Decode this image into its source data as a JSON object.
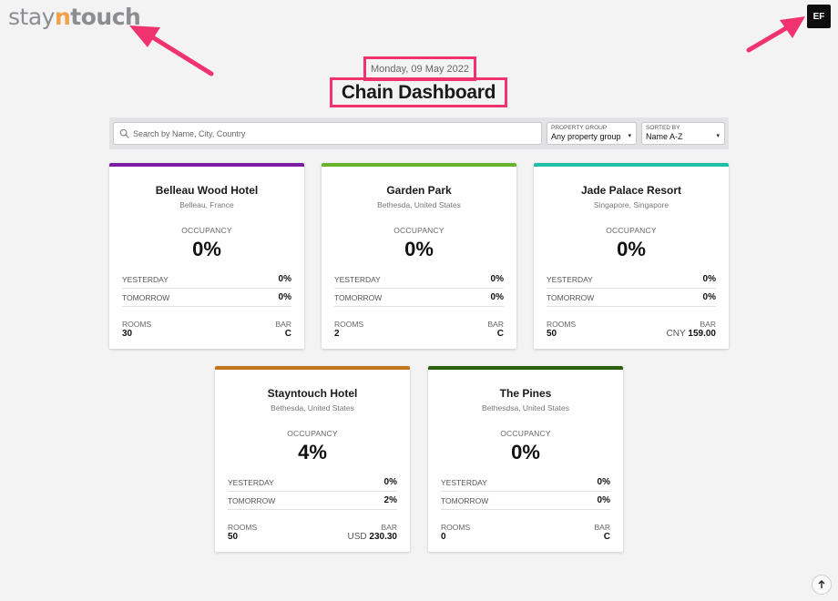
{
  "brand": {
    "part1": "stay",
    "part2": "n",
    "part3": "touch",
    "accent": "#f0a24a"
  },
  "user": {
    "initials": "EF"
  },
  "header": {
    "date": "Monday, 09 May 2022",
    "title": "Chain Dashboard"
  },
  "filters": {
    "search_placeholder": "Search by Name, City, Country",
    "property_group": {
      "label": "PROPERTY GROUP",
      "value": "Any property group"
    },
    "sorted_by": {
      "label": "SORTED BY",
      "value": "Name A-Z"
    }
  },
  "labels": {
    "occupancy": "OCCUPANCY",
    "yesterday": "YESTERDAY",
    "tomorrow": "TOMORROW",
    "rooms": "ROOMS",
    "bar": "BAR"
  },
  "hotels": [
    {
      "name": "Belleau Wood Hotel",
      "location": "Belleau, France",
      "occupancy": "0%",
      "yesterday": "0%",
      "tomorrow": "0%",
      "rooms": "30",
      "bar_currency": "",
      "bar_value": "C",
      "color": "#7b1fa2"
    },
    {
      "name": "Garden Park",
      "location": "Bethesda, United States",
      "occupancy": "0%",
      "yesterday": "0%",
      "tomorrow": "0%",
      "rooms": "2",
      "bar_currency": "",
      "bar_value": "C",
      "color": "#6ab42d"
    },
    {
      "name": "Jade Palace Resort",
      "location": "Singapore, Singapore",
      "occupancy": "0%",
      "yesterday": "0%",
      "tomorrow": "0%",
      "rooms": "50",
      "bar_currency": "CNY",
      "bar_value": "159.00",
      "color": "#1fbfa5"
    },
    {
      "name": "Stayntouch Hotel",
      "location": "Bethesda, United States",
      "occupancy": "4%",
      "yesterday": "0%",
      "tomorrow": "2%",
      "rooms": "50",
      "bar_currency": "USD",
      "bar_value": "230.30",
      "color": "#c0741b"
    },
    {
      "name": "The Pines",
      "location": "Bethesdsa, United States",
      "occupancy": "0%",
      "yesterday": "0%",
      "tomorrow": "0%",
      "rooms": "0",
      "bar_currency": "",
      "bar_value": "C",
      "color": "#2c5f10"
    }
  ]
}
